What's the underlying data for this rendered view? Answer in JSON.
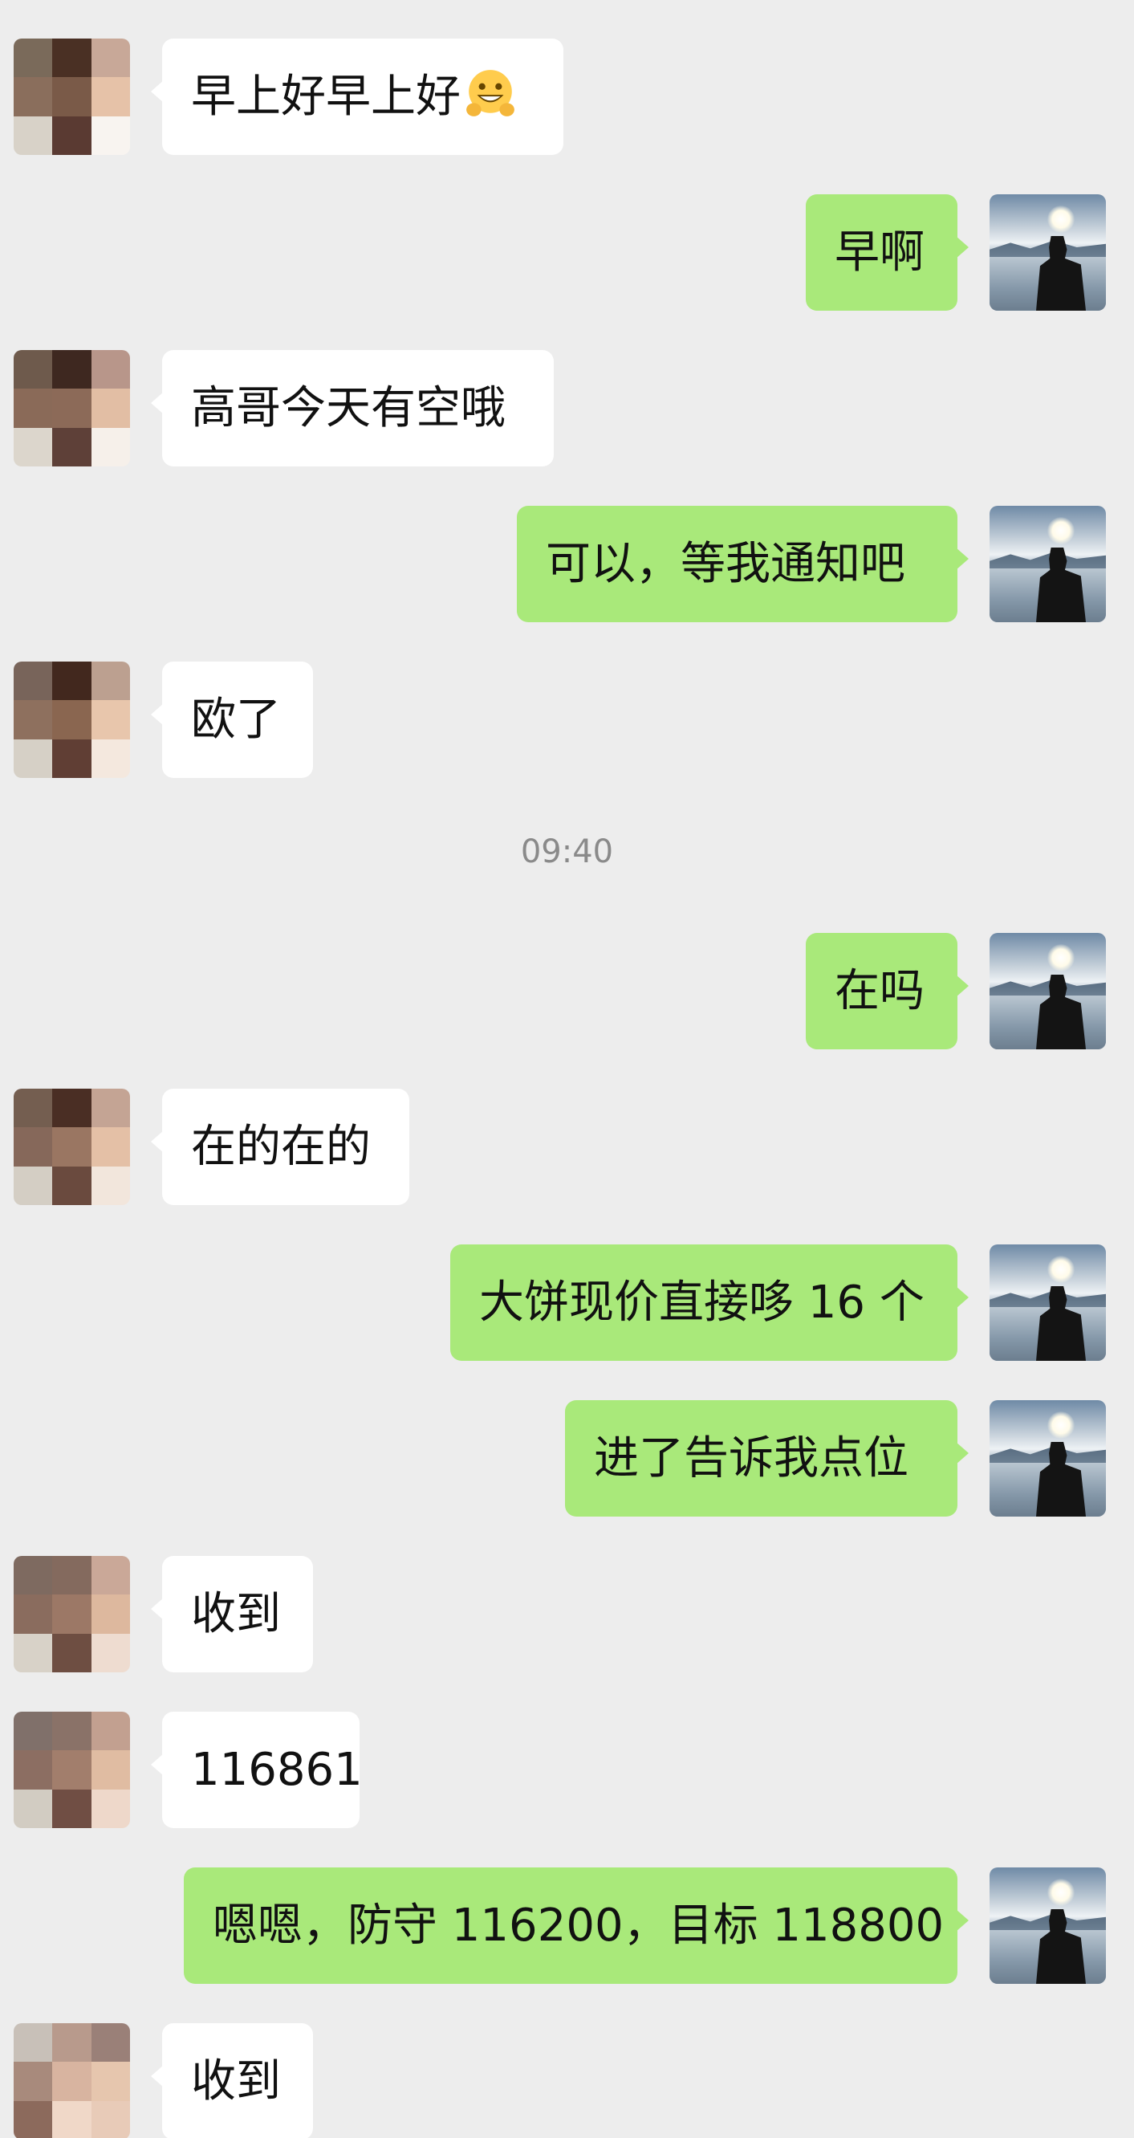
{
  "messages": [
    {
      "side": "in",
      "text": "早上好早上好",
      "emoji": "grinning-hands-emoji"
    },
    {
      "side": "out",
      "text": "早啊"
    },
    {
      "side": "in",
      "text": "高哥今天有空哦"
    },
    {
      "side": "out",
      "text": "可以，等我通知吧"
    },
    {
      "side": "in",
      "text": "欧了"
    },
    {
      "side": "out",
      "text": "在吗"
    },
    {
      "side": "in",
      "text": "在的在的"
    },
    {
      "side": "out",
      "text": "大饼现价直接哆 16 个"
    },
    {
      "side": "out",
      "text": "进了告诉我点位"
    },
    {
      "side": "in",
      "text": "收到"
    },
    {
      "side": "in",
      "text": "116861"
    },
    {
      "side": "out",
      "text": "嗯嗯，防守 116200，目标 118800"
    },
    {
      "side": "in",
      "text": "收到"
    }
  ],
  "timestamp": "09:40",
  "colors": {
    "background": "#ededed",
    "incoming_bubble": "#ffffff",
    "outgoing_bubble": "#a9e97a",
    "timestamp_text": "#8a8a8a"
  },
  "avatars": {
    "contact": "pixelated-avatar",
    "self": "landscape-lake-avatar"
  }
}
